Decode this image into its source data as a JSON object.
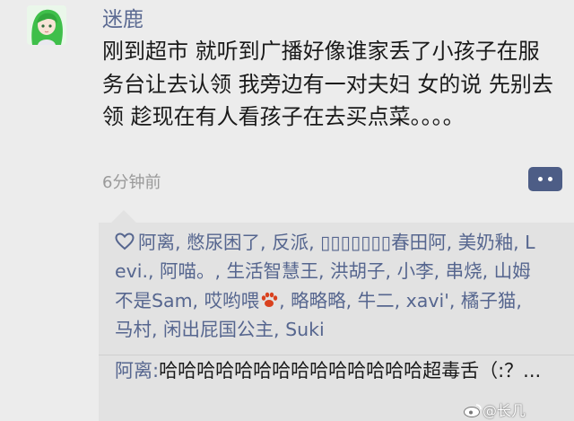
{
  "post": {
    "author": "迷鹿",
    "body": "刚到超市 就听到广播好像谁家丢了小孩子在服务台让去认领 我旁边有一对夫妇 女的说 先别去领 趁现在有人看孩子在去买点菜。。。。",
    "time": "6分钟前"
  },
  "likes": {
    "text": "阿离, 憋尿困了, 反派, ▯▯▯▯▯▯▯春田阿, 美奶釉, Levi., 阿喵。, 生活智慧王, 洪胡子, 小李, 串烧, 山姆不是Sam, 哎哟喂",
    "text_after_emoji": ", 略略略, 牛二, xavi', 橘子猫, 马村, 闲出屁国公主, Suki"
  },
  "comment": {
    "author": "阿离:",
    "text": "哈哈哈哈哈哈哈哈哈哈哈哈哈哈超毒舌（:？..."
  },
  "watermark": {
    "text": "@长几"
  },
  "colors": {
    "background": "#ececec",
    "name": "#5b6a92",
    "link": "#56668f",
    "more_button": "#4d5d86",
    "paw": "#d9421f"
  }
}
